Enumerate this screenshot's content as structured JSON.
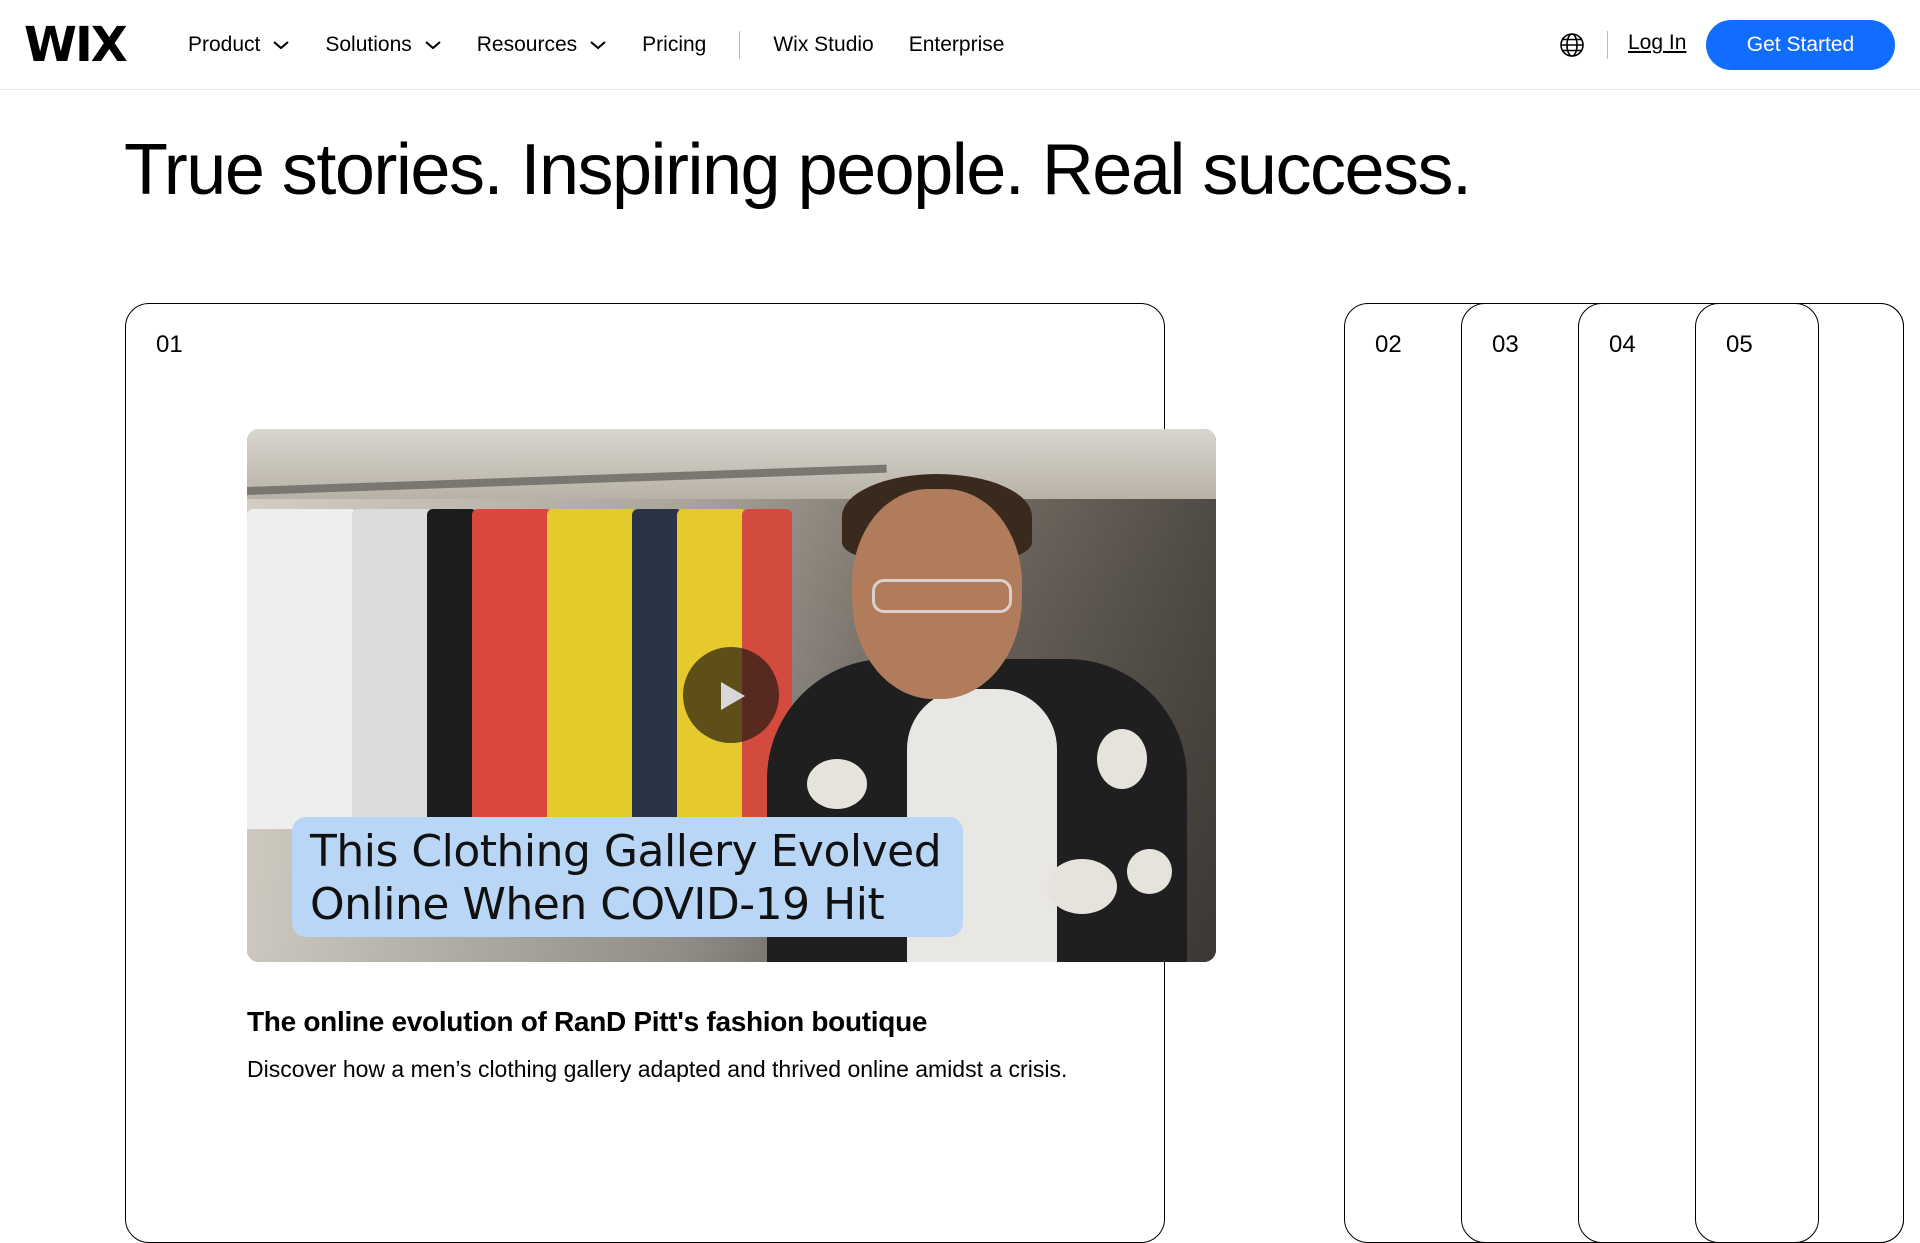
{
  "brand": {
    "logo": "WIX"
  },
  "nav": {
    "items": [
      {
        "label": "Product",
        "has_dropdown": true
      },
      {
        "label": "Solutions",
        "has_dropdown": true
      },
      {
        "label": "Resources",
        "has_dropdown": true
      },
      {
        "label": "Pricing",
        "has_dropdown": false
      }
    ],
    "secondary": [
      {
        "label": "Wix Studio"
      },
      {
        "label": "Enterprise"
      }
    ]
  },
  "header_right": {
    "language_icon": "globe-icon",
    "login_label": "Log In",
    "cta_label": "Get Started",
    "cta_color": "#116dff"
  },
  "headline": "True stories. Inspiring people. Real success.",
  "stories": {
    "panels": [
      {
        "number": "01"
      },
      {
        "number": "02"
      },
      {
        "number": "03"
      },
      {
        "number": "04"
      },
      {
        "number": "05"
      }
    ],
    "active": {
      "video_caption_line1": "This Clothing Gallery Evolved",
      "video_caption_line2": "Online When COVID-19 Hit",
      "play_icon": "play-icon",
      "title": "The online evolution of RanD Pitt's fashion boutique",
      "description": "Discover how a men’s clothing gallery adapted and thrived online amidst a crisis."
    }
  }
}
